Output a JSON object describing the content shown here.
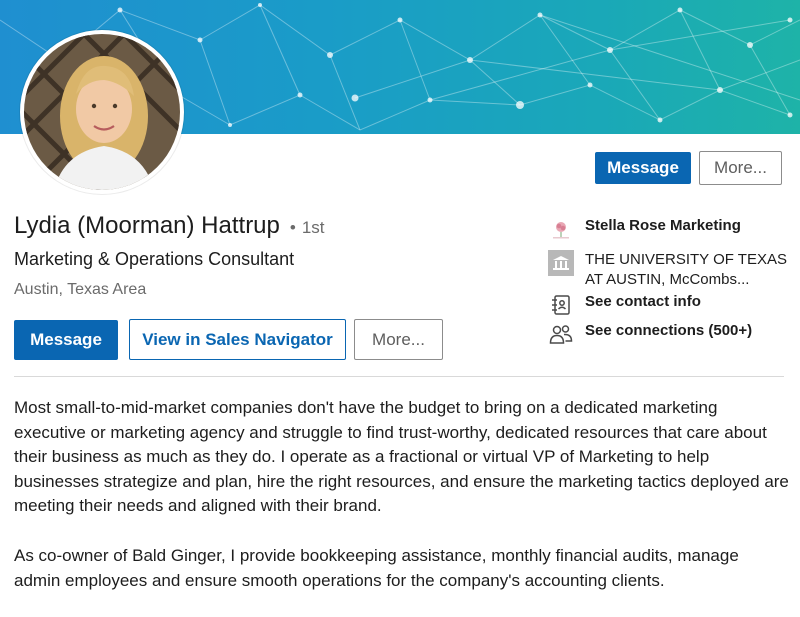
{
  "profile": {
    "name": "Lydia (Moorman) Hattrup",
    "degree_dot": "•",
    "degree": "1st",
    "headline": "Marketing & Operations Consultant",
    "location": "Austin, Texas Area"
  },
  "top_actions": {
    "message_label": "Message",
    "more_label": "More..."
  },
  "actions": {
    "message_label": "Message",
    "sales_navigator_label": "View in Sales Navigator",
    "more_label": "More..."
  },
  "sidebar": {
    "company": "Stella Rose Marketing",
    "school_line1": "THE UNIVERSITY OF TEXAS",
    "school_line2": "AT AUSTIN, McCombs...",
    "contact_info": "See contact info",
    "connections": "See connections (500+)"
  },
  "about": {
    "paragraph1": "Most small-to-mid-market companies don't have the budget to bring on a dedicated marketing executive or marketing agency and struggle to find trust-worthy, dedicated resources that care about their business as much as they do. I operate as a fractional or virtual VP of Marketing to help businesses strategize and plan, hire the right resources, and ensure the marketing tactics deployed are meeting their needs and aligned with their brand.",
    "paragraph2": "As co-owner of Bald Ginger, I provide bookkeeping assistance, monthly financial audits, manage admin employees and ensure smooth operations for the company's accounting clients."
  },
  "colors": {
    "primary": "#0a66b2",
    "banner_start": "#1f8fd0",
    "banner_end": "#1eb3a8"
  },
  "icons": {
    "company": "rose-logo-icon",
    "school": "university-building-icon",
    "contact": "contact-card-icon",
    "connections": "people-icon"
  }
}
